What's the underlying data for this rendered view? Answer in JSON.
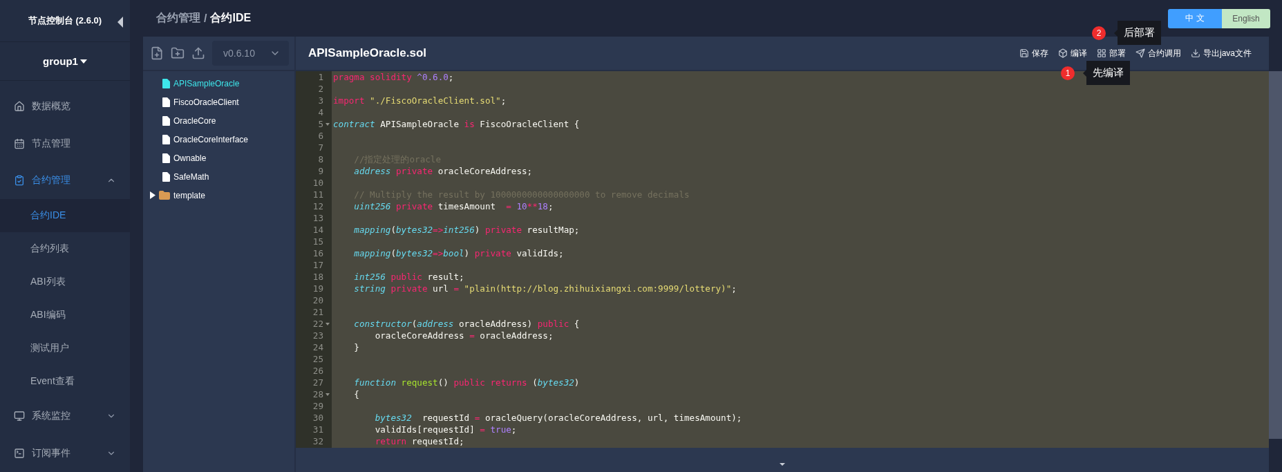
{
  "sidebar": {
    "title": "节点控制台 (2.6.0)",
    "group": "group1",
    "menu": [
      {
        "label": "数据概览",
        "selected": false
      },
      {
        "label": "节点管理",
        "selected": false
      },
      {
        "label": "合约管理",
        "selected": true,
        "expanded": true,
        "children": [
          {
            "label": "合约IDE",
            "selected": true
          },
          {
            "label": "合约列表",
            "selected": false
          },
          {
            "label": "ABI列表",
            "selected": false
          },
          {
            "label": "ABI编码",
            "selected": false
          },
          {
            "label": "测试用户",
            "selected": false
          },
          {
            "label": "Event查看",
            "selected": false
          }
        ]
      },
      {
        "label": "系统监控",
        "selected": false,
        "expanded": false
      },
      {
        "label": "订阅事件",
        "selected": false,
        "expanded": false
      }
    ]
  },
  "breadcrumb": {
    "parent": "合约管理",
    "separator": "/",
    "current": "合约IDE"
  },
  "language": [
    {
      "label": "中 文",
      "selected": true
    },
    {
      "label": "English",
      "selected": false
    }
  ],
  "file_tree": {
    "version": "v0.6.10",
    "items": [
      {
        "label": "APISampleOracle",
        "kind": "file",
        "selected": true
      },
      {
        "label": "FiscoOracleClient",
        "kind": "file",
        "selected": false
      },
      {
        "label": "OracleCore",
        "kind": "file",
        "selected": false
      },
      {
        "label": "OracleCoreInterface",
        "kind": "file",
        "selected": false
      },
      {
        "label": "Ownable",
        "kind": "file",
        "selected": false
      },
      {
        "label": "SafeMath",
        "kind": "file",
        "selected": false
      },
      {
        "label": "template",
        "kind": "folder",
        "selected": false,
        "expanded": false
      }
    ]
  },
  "editor": {
    "filename": "APISampleOracle.sol",
    "actions": [
      "保存",
      "编译",
      "部署",
      "合约调用",
      "导出java文件"
    ],
    "tooltips": [
      {
        "badge": "2",
        "text": "后部署"
      },
      {
        "badge": "1",
        "text": "先编译"
      }
    ],
    "lines": [
      {
        "number": "1",
        "tokens": [
          {
            "kind": "keyword",
            "text": "pragma solidity "
          },
          {
            "kind": "number",
            "text": "^0.6.0"
          },
          {
            "kind": "plain",
            "text": ";"
          }
        ]
      },
      {
        "number": "2"
      },
      {
        "number": "3",
        "tokens": [
          {
            "kind": "keyword",
            "text": "import "
          },
          {
            "kind": "string",
            "text": "\"./FiscoOracleClient.sol\""
          },
          {
            "kind": "plain",
            "text": ";"
          }
        ]
      },
      {
        "number": "4"
      },
      {
        "number": "5",
        "fold": true,
        "tokens": [
          {
            "kind": "type",
            "text": "contract"
          },
          {
            "kind": "plain",
            "text": " APISampleOracle "
          },
          {
            "kind": "keyword",
            "text": "is"
          },
          {
            "kind": "plain",
            "text": " FiscoOracleClient {"
          }
        ]
      },
      {
        "number": "6"
      },
      {
        "number": "7"
      },
      {
        "number": "8",
        "tokens": [
          {
            "kind": "comment",
            "text": "    //指定处理的oracle"
          }
        ]
      },
      {
        "number": "9",
        "tokens": [
          {
            "kind": "type",
            "text": "    address "
          },
          {
            "kind": "keyword",
            "text": "private"
          },
          {
            "kind": "plain",
            "text": " oracleCoreAddress;"
          }
        ]
      },
      {
        "number": "10"
      },
      {
        "number": "11",
        "tokens": [
          {
            "kind": "comment",
            "text": "    // Multiply the result by 1000000000000000000 to remove decimals"
          }
        ]
      },
      {
        "number": "12",
        "tokens": [
          {
            "kind": "type",
            "text": "    uint256 "
          },
          {
            "kind": "keyword",
            "text": "private"
          },
          {
            "kind": "plain",
            "text": " timesAmount  "
          },
          {
            "kind": "keyword",
            "text": "= "
          },
          {
            "kind": "number",
            "text": "10"
          },
          {
            "kind": "keyword",
            "text": "**"
          },
          {
            "kind": "number",
            "text": "18"
          },
          {
            "kind": "plain",
            "text": ";"
          }
        ]
      },
      {
        "number": "13"
      },
      {
        "number": "14",
        "tokens": [
          {
            "kind": "type",
            "text": "    mapping"
          },
          {
            "kind": "plain",
            "text": "("
          },
          {
            "kind": "type",
            "text": "bytes32"
          },
          {
            "kind": "keyword",
            "text": "=>"
          },
          {
            "kind": "type",
            "text": "int256"
          },
          {
            "kind": "plain",
            "text": ") "
          },
          {
            "kind": "keyword",
            "text": "private"
          },
          {
            "kind": "plain",
            "text": " resultMap;"
          }
        ]
      },
      {
        "number": "15"
      },
      {
        "number": "16",
        "tokens": [
          {
            "kind": "type",
            "text": "    mapping"
          },
          {
            "kind": "plain",
            "text": "("
          },
          {
            "kind": "type",
            "text": "bytes32"
          },
          {
            "kind": "keyword",
            "text": "=>"
          },
          {
            "kind": "type",
            "text": "bool"
          },
          {
            "kind": "plain",
            "text": ") "
          },
          {
            "kind": "keyword",
            "text": "private"
          },
          {
            "kind": "plain",
            "text": " validIds;"
          }
        ]
      },
      {
        "number": "17"
      },
      {
        "number": "18",
        "tokens": [
          {
            "kind": "type",
            "text": "    int256 "
          },
          {
            "kind": "keyword",
            "text": "public"
          },
          {
            "kind": "plain",
            "text": " result;"
          }
        ]
      },
      {
        "number": "19",
        "tokens": [
          {
            "kind": "type",
            "text": "    string "
          },
          {
            "kind": "keyword",
            "text": "private"
          },
          {
            "kind": "plain",
            "text": " url "
          },
          {
            "kind": "keyword",
            "text": "= "
          },
          {
            "kind": "string",
            "text": "\"plain(http://blog.zhihuixiangxi.com:9999/lottery)\""
          },
          {
            "kind": "plain",
            "text": ";"
          }
        ]
      },
      {
        "number": "20"
      },
      {
        "number": "21"
      },
      {
        "number": "22",
        "fold": true,
        "tokens": [
          {
            "kind": "type",
            "text": "    constructor"
          },
          {
            "kind": "plain",
            "text": "("
          },
          {
            "kind": "type",
            "text": "address"
          },
          {
            "kind": "plain",
            "text": " oracleAddress) "
          },
          {
            "kind": "keyword",
            "text": "public"
          },
          {
            "kind": "plain",
            "text": " {"
          }
        ]
      },
      {
        "number": "23",
        "tokens": [
          {
            "kind": "plain",
            "text": "        oracleCoreAddress "
          },
          {
            "kind": "keyword",
            "text": "="
          },
          {
            "kind": "plain",
            "text": " oracleAddress;"
          }
        ]
      },
      {
        "number": "24",
        "tokens": [
          {
            "kind": "plain",
            "text": "    }"
          }
        ]
      },
      {
        "number": "25"
      },
      {
        "number": "26"
      },
      {
        "number": "27",
        "tokens": [
          {
            "kind": "type",
            "text": "    function "
          },
          {
            "kind": "func",
            "text": "request"
          },
          {
            "kind": "plain",
            "text": "() "
          },
          {
            "kind": "keyword",
            "text": "public returns"
          },
          {
            "kind": "plain",
            "text": " ("
          },
          {
            "kind": "type",
            "text": "bytes32"
          },
          {
            "kind": "plain",
            "text": ")"
          }
        ]
      },
      {
        "number": "28",
        "fold": true,
        "tokens": [
          {
            "kind": "plain",
            "text": "    {"
          }
        ]
      },
      {
        "number": "29"
      },
      {
        "number": "30",
        "tokens": [
          {
            "kind": "type",
            "text": "        bytes32"
          },
          {
            "kind": "plain",
            "text": "  requestId "
          },
          {
            "kind": "keyword",
            "text": "="
          },
          {
            "kind": "plain",
            "text": " oracleQuery(oracleCoreAddress, url, timesAmount);"
          }
        ]
      },
      {
        "number": "31",
        "tokens": [
          {
            "kind": "plain",
            "text": "        validIds[requestId] "
          },
          {
            "kind": "keyword",
            "text": "= "
          },
          {
            "kind": "number",
            "text": "true"
          },
          {
            "kind": "plain",
            "text": ";"
          }
        ]
      },
      {
        "number": "32",
        "tokens": [
          {
            "kind": "keyword",
            "text": "        return"
          },
          {
            "kind": "plain",
            "text": " requestId;"
          }
        ]
      }
    ]
  }
}
